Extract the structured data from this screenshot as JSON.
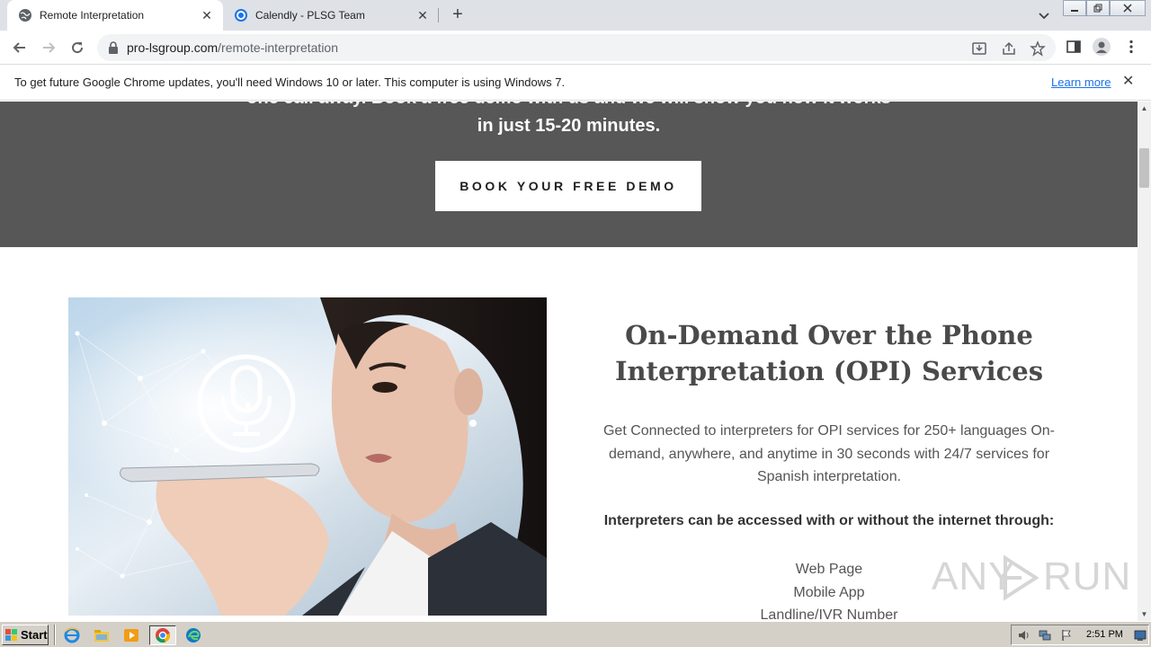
{
  "browser": {
    "tabs": [
      {
        "title": "Remote Interpretation",
        "active": true,
        "favicon": "globe-icon"
      },
      {
        "title": "Calendly - PLSG Team",
        "active": false,
        "favicon": "calendly-icon"
      }
    ],
    "new_tab": "+",
    "url_host": "pro-lsgroup.com",
    "url_path": "/remote-interpretation"
  },
  "infobar": {
    "message": "To get future Google Chrome updates, you'll need Windows 10 or later. This computer is using Windows 7.",
    "link": "Learn more"
  },
  "page": {
    "hero": {
      "cut_line": "one call away. Book a free demo with us and we will show you how it works",
      "line2": "in just 15-20 minutes.",
      "cta": "BOOK YOUR FREE DEMO"
    },
    "section": {
      "heading_line1": "On-Demand Over the Phone",
      "heading_line2": "Interpretation (OPI) Services",
      "desc_line1": "Get Connected to interpreters for OPI services for 250+ languages On-",
      "desc_line2": "demand, anywhere, and anytime in 30 seconds with 24/7 services for",
      "desc_line3": "Spanish interpretation.",
      "access_line": "Interpreters can be accessed with or without the internet through:",
      "channels": [
        "Web Page",
        "Mobile App",
        "Landline/IVR Number"
      ]
    },
    "watermark_left": "ANY",
    "watermark_right": "RUN"
  },
  "taskbar": {
    "start": "Start",
    "clock": "2:51 PM"
  },
  "colors": {
    "hero_bg": "#575757",
    "link": "#1a73e8",
    "heading": "#4a4a4a"
  }
}
